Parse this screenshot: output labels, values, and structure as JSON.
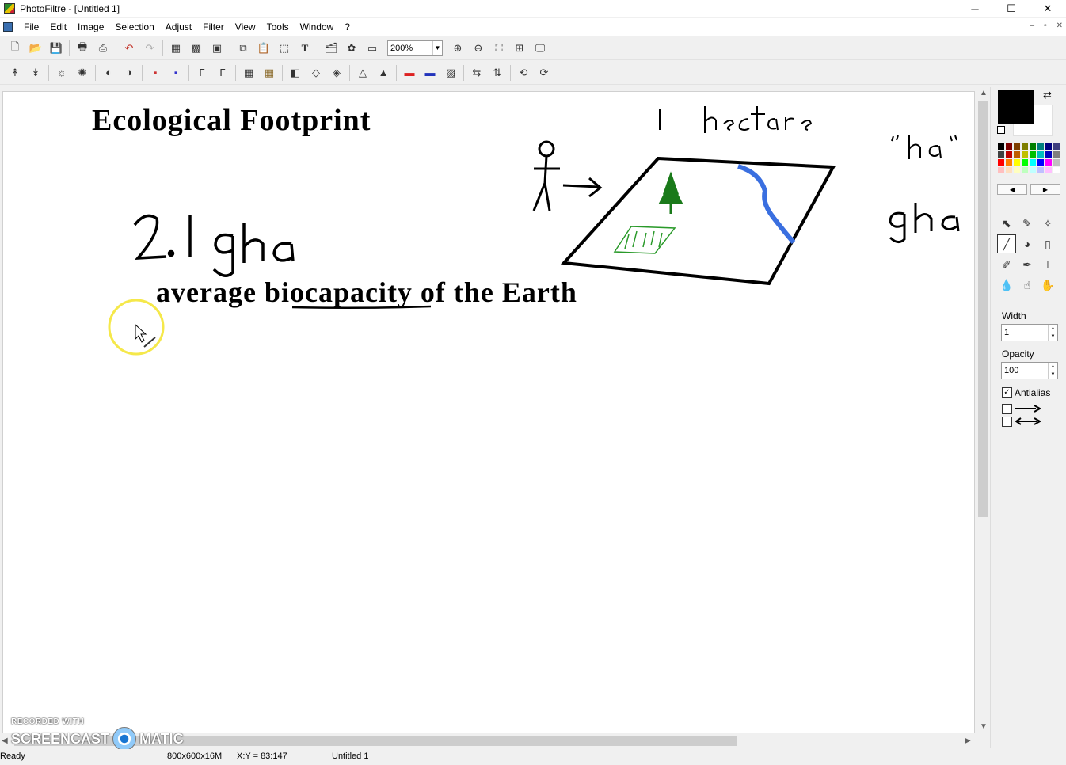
{
  "window": {
    "title": "PhotoFiltre - [Untitled 1]",
    "minimize": "─",
    "maximize": "☐",
    "close": "✕"
  },
  "menu": {
    "items": [
      "File",
      "Edit",
      "Image",
      "Selection",
      "Adjust",
      "Filter",
      "View",
      "Tools",
      "Window",
      "?"
    ],
    "mdi": [
      "–",
      "▫",
      "✕"
    ]
  },
  "toolbar1": {
    "zoom_value": "200%",
    "icons": [
      "new-icon",
      "open-icon",
      "save-icon",
      "print-icon",
      "scan-icon",
      "undo-icon",
      "redo-icon",
      "fill-icon",
      "color-icon",
      "image-icon",
      "copy-icon",
      "paste-icon",
      "crop-icon",
      "text-icon",
      "browser-icon",
      "plugin-icon",
      "window-icon",
      "zoom-in-icon",
      "zoom-out-icon",
      "fit-icon",
      "actual-size-icon",
      "fullscreen-icon"
    ]
  },
  "canvas": {
    "title": "Ecological Footprint",
    "subtitle": "average biocapacity of the Earth",
    "handwritten": {
      "number": "2.1 gha",
      "one": "1",
      "hectare": "hectare",
      "quote_ha": "“ha”",
      "gha": "gha"
    },
    "colors": {
      "river": "#3a6fe0",
      "tree": "#1a7a1a",
      "field": "#2a9a2a",
      "cursor_ring": "#f5e84a"
    }
  },
  "panel": {
    "width_label": "Width",
    "width_value": "1",
    "opacity_label": "Opacity",
    "opacity_value": "100",
    "antialias_label": "Antialias",
    "antialias_checked": "✓",
    "palette": [
      "#000000",
      "#7f0000",
      "#7f3f00",
      "#7f7f00",
      "#007f00",
      "#007f7f",
      "#00007f",
      "#3f3f7f",
      "#404040",
      "#bf0000",
      "#bf5f00",
      "#bfbf00",
      "#00bf00",
      "#00bfbf",
      "#0000bf",
      "#7f7f7f",
      "#ff0000",
      "#ff7f00",
      "#ffff00",
      "#00ff00",
      "#00ffff",
      "#0000ff",
      "#ff00ff",
      "#bfbfbf",
      "#ffbfbf",
      "#ffdfbf",
      "#ffffbf",
      "#bfffbf",
      "#bfffff",
      "#bfbfff",
      "#ffbfff",
      "#ffffff"
    ]
  },
  "statusbar": {
    "state": "Ready",
    "image_info": "800x600x16M",
    "coords": "X:Y = 83:147",
    "doc_name": "Untitled 1"
  },
  "watermark": {
    "line1": "RECORDED WITH",
    "line2a": "SCREENCAST",
    "line2b": "MATIC"
  }
}
